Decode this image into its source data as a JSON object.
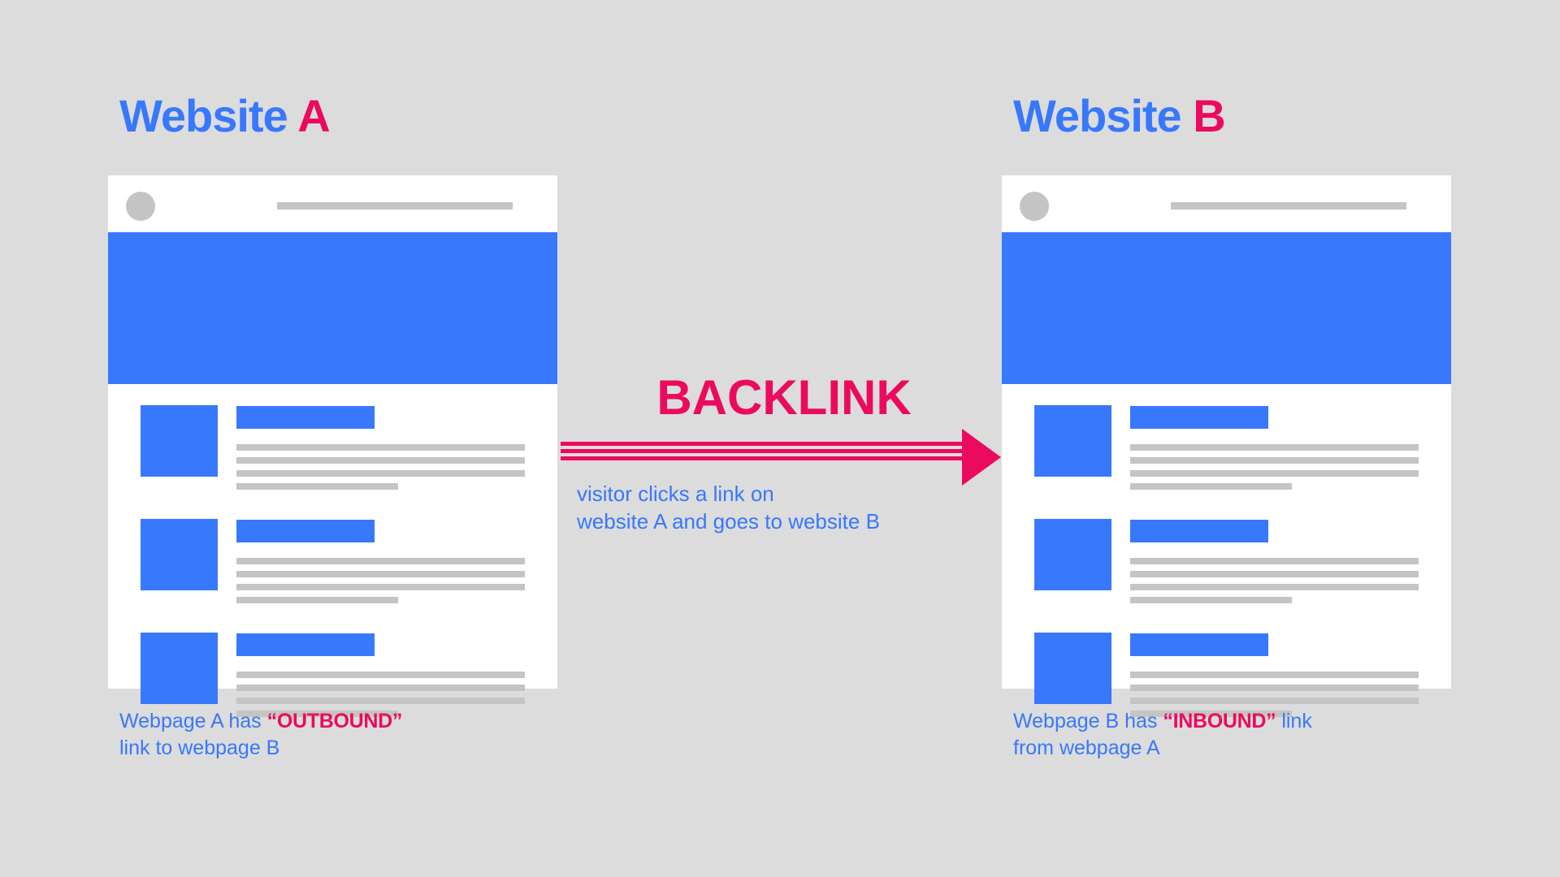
{
  "theme": {
    "background": "#dcdcdc",
    "blue": "#3778fc",
    "pink": "#ec0a5e",
    "placeholder_gray": "#c4c4c4",
    "card_background": "#ffffff"
  },
  "websites": [
    {
      "title_main": "Website",
      "title_accent": "A",
      "caption": {
        "before": "Webpage A has ",
        "open_quote": "“",
        "keyword": "OUTBOUND",
        "close_quote": "”",
        "after": "",
        "second_line": "link to webpage B"
      },
      "rows": [
        {
          "lines": 4
        },
        {
          "lines": 4
        },
        {
          "lines": 4
        }
      ]
    },
    {
      "title_main": "Website",
      "title_accent": "B",
      "caption": {
        "before": "Webpage B has ",
        "open_quote": "“",
        "keyword": "INBOUND",
        "close_quote": "”",
        "after": " link",
        "second_line": "from webpage A"
      },
      "rows": [
        {
          "lines": 4
        },
        {
          "lines": 4
        },
        {
          "lines": 4
        }
      ]
    }
  ],
  "connector": {
    "label": "BACKLINK",
    "subtitle_line1": "visitor clicks a link on",
    "subtitle_line2": "website A and goes to website B",
    "direction": "right"
  }
}
